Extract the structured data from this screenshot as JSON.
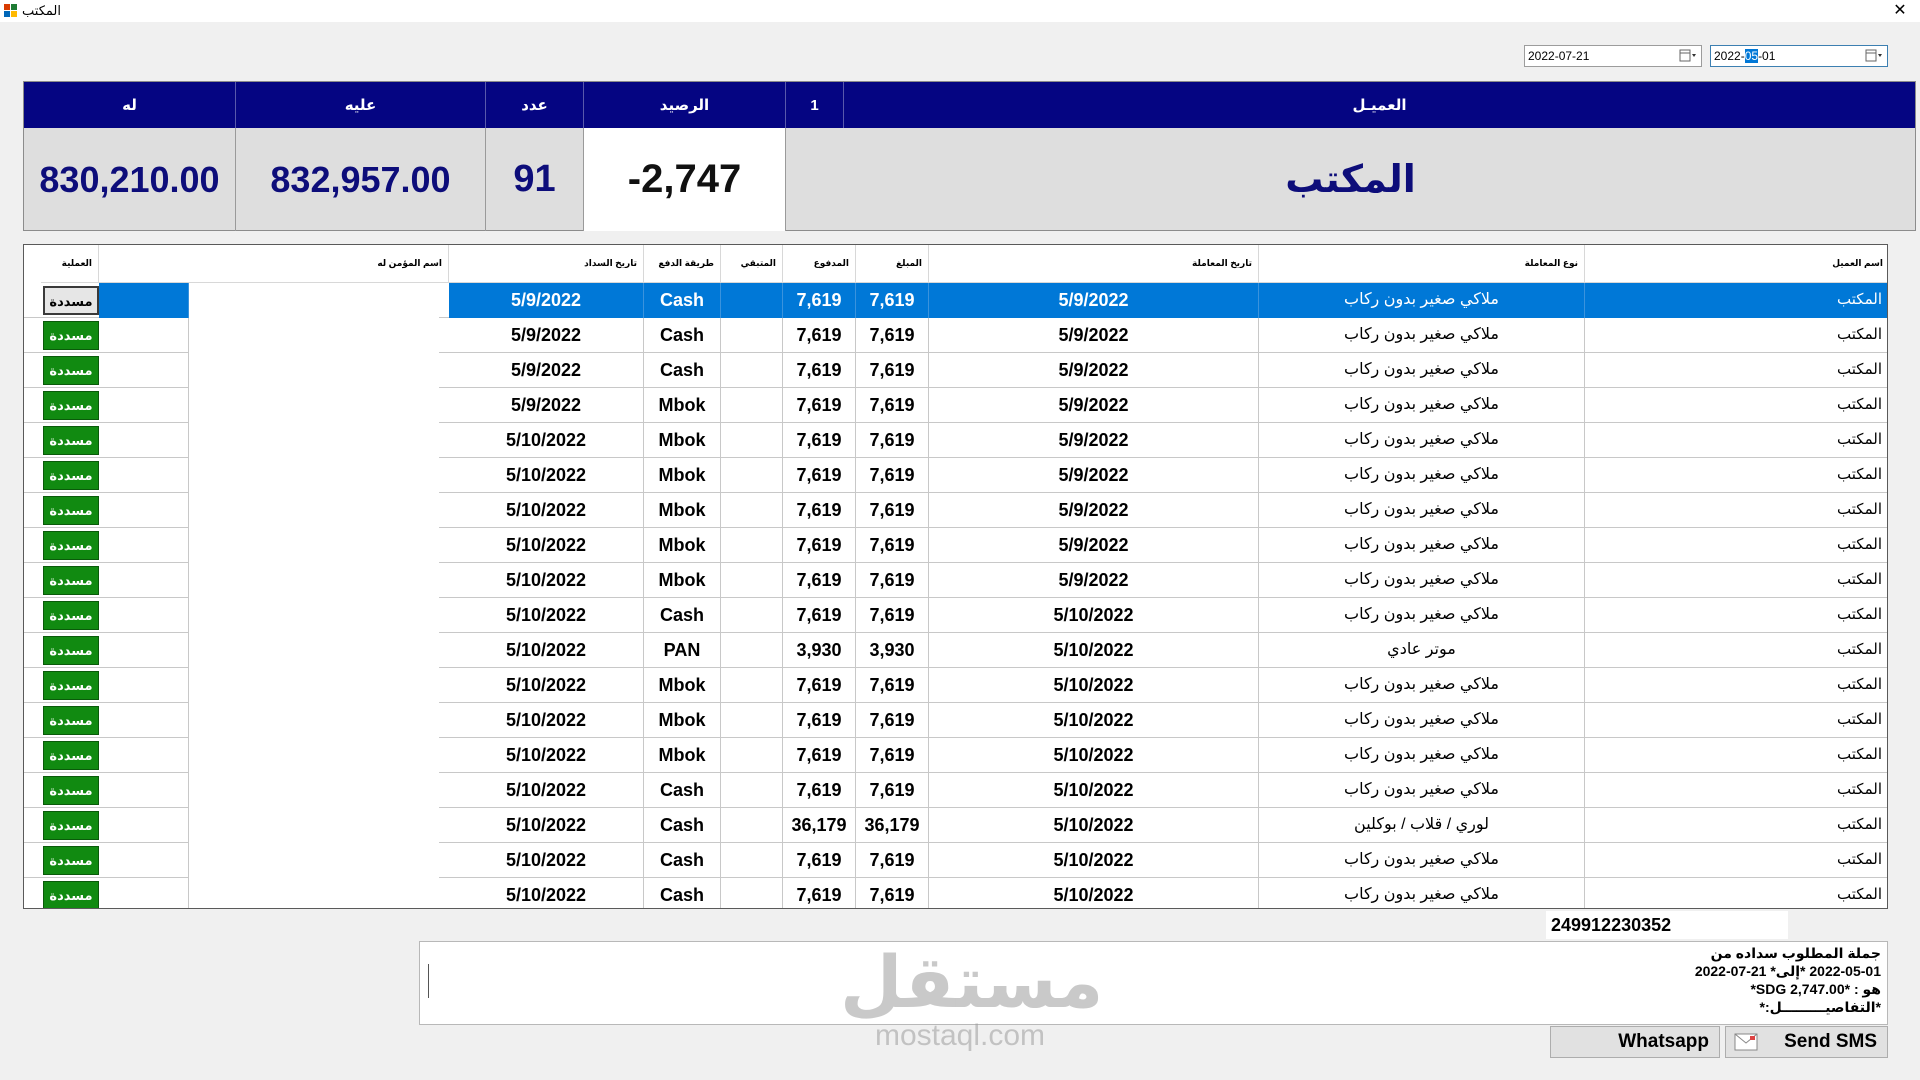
{
  "window": {
    "title": "المكتب",
    "close_symbol": "✕"
  },
  "date_from": {
    "value_pre": "2022-",
    "value_sel": "05",
    "value_post": "-01"
  },
  "date_to": {
    "value": "2022-07-21"
  },
  "summary": {
    "headers": {
      "customer": "العميـل",
      "index": "1",
      "balance": "الرصيد",
      "count": "عدد",
      "debit": "عليه",
      "credit": "له"
    },
    "values": {
      "customer": "المكتب",
      "balance": "-2,747",
      "count": "91",
      "debit": "832,957.00",
      "credit": "830,210.00"
    }
  },
  "grid": {
    "columns": {
      "customer": "اسم العميل",
      "type": "نوع المعاملة",
      "txn_date": "تاريخ المعاملة",
      "amount": "المبلغ",
      "paid": "المدفوع",
      "remaining": "المتبقي",
      "method": "طريقة الدفع",
      "pay_date": "تاريخ السداد",
      "insured": "اسم المؤمن له",
      "op": "العملية"
    },
    "rows": [
      {
        "customer": "المكتب",
        "type": "ملاكي صغير بدون ركاب",
        "txn_date": "5/9/2022",
        "amount": "7,619",
        "paid": "7,619",
        "remaining": "",
        "method": "Cash",
        "pay_date": "5/9/2022",
        "insured": "",
        "op": "مسددة",
        "selected": true
      },
      {
        "customer": "المكتب",
        "type": "ملاكي صغير بدون ركاب",
        "txn_date": "5/9/2022",
        "amount": "7,619",
        "paid": "7,619",
        "remaining": "",
        "method": "Cash",
        "pay_date": "5/9/2022",
        "insured": "",
        "op": "مسددة"
      },
      {
        "customer": "المكتب",
        "type": "ملاكي صغير بدون ركاب",
        "txn_date": "5/9/2022",
        "amount": "7,619",
        "paid": "7,619",
        "remaining": "",
        "method": "Cash",
        "pay_date": "5/9/2022",
        "insured": "",
        "op": "مسددة"
      },
      {
        "customer": "المكتب",
        "type": "ملاكي صغير بدون ركاب",
        "txn_date": "5/9/2022",
        "amount": "7,619",
        "paid": "7,619",
        "remaining": "",
        "method": "Mbok",
        "pay_date": "5/9/2022",
        "insured": "",
        "op": "مسددة"
      },
      {
        "customer": "المكتب",
        "type": "ملاكي صغير بدون ركاب",
        "txn_date": "5/9/2022",
        "amount": "7,619",
        "paid": "7,619",
        "remaining": "",
        "method": "Mbok",
        "pay_date": "5/10/2022",
        "insured": "",
        "op": "مسددة"
      },
      {
        "customer": "المكتب",
        "type": "ملاكي صغير بدون ركاب",
        "txn_date": "5/9/2022",
        "amount": "7,619",
        "paid": "7,619",
        "remaining": "",
        "method": "Mbok",
        "pay_date": "5/10/2022",
        "insured": "",
        "op": "مسددة"
      },
      {
        "customer": "المكتب",
        "type": "ملاكي صغير بدون ركاب",
        "txn_date": "5/9/2022",
        "amount": "7,619",
        "paid": "7,619",
        "remaining": "",
        "method": "Mbok",
        "pay_date": "5/10/2022",
        "insured": "",
        "op": "مسددة"
      },
      {
        "customer": "المكتب",
        "type": "ملاكي صغير بدون ركاب",
        "txn_date": "5/9/2022",
        "amount": "7,619",
        "paid": "7,619",
        "remaining": "",
        "method": "Mbok",
        "pay_date": "5/10/2022",
        "insured": "",
        "op": "مسددة"
      },
      {
        "customer": "المكتب",
        "type": "ملاكي صغير بدون ركاب",
        "txn_date": "5/9/2022",
        "amount": "7,619",
        "paid": "7,619",
        "remaining": "",
        "method": "Mbok",
        "pay_date": "5/10/2022",
        "insured": "",
        "op": "مسددة"
      },
      {
        "customer": "المكتب",
        "type": "ملاكي صغير بدون ركاب",
        "txn_date": "5/10/2022",
        "amount": "7,619",
        "paid": "7,619",
        "remaining": "",
        "method": "Cash",
        "pay_date": "5/10/2022",
        "insured": "",
        "op": "مسددة"
      },
      {
        "customer": "المكتب",
        "type": "موتر عادي",
        "txn_date": "5/10/2022",
        "amount": "3,930",
        "paid": "3,930",
        "remaining": "",
        "method": "PAN",
        "pay_date": "5/10/2022",
        "insured": "",
        "op": "مسددة"
      },
      {
        "customer": "المكتب",
        "type": "ملاكي صغير بدون ركاب",
        "txn_date": "5/10/2022",
        "amount": "7,619",
        "paid": "7,619",
        "remaining": "",
        "method": "Mbok",
        "pay_date": "5/10/2022",
        "insured": "",
        "op": "مسددة"
      },
      {
        "customer": "المكتب",
        "type": "ملاكي صغير بدون ركاب",
        "txn_date": "5/10/2022",
        "amount": "7,619",
        "paid": "7,619",
        "remaining": "",
        "method": "Mbok",
        "pay_date": "5/10/2022",
        "insured": "",
        "op": "مسددة"
      },
      {
        "customer": "المكتب",
        "type": "ملاكي صغير بدون ركاب",
        "txn_date": "5/10/2022",
        "amount": "7,619",
        "paid": "7,619",
        "remaining": "",
        "method": "Mbok",
        "pay_date": "5/10/2022",
        "insured": "",
        "op": "مسددة"
      },
      {
        "customer": "المكتب",
        "type": "ملاكي صغير بدون ركاب",
        "txn_date": "5/10/2022",
        "amount": "7,619",
        "paid": "7,619",
        "remaining": "",
        "method": "Cash",
        "pay_date": "5/10/2022",
        "insured": "",
        "op": "مسددة"
      },
      {
        "customer": "المكتب",
        "type": "لوري / قلاب / بوكلين",
        "txn_date": "5/10/2022",
        "amount": "36,179",
        "paid": "36,179",
        "remaining": "",
        "method": "Cash",
        "pay_date": "5/10/2022",
        "insured": "",
        "op": "مسددة"
      },
      {
        "customer": "المكتب",
        "type": "ملاكي صغير بدون ركاب",
        "txn_date": "5/10/2022",
        "amount": "7,619",
        "paid": "7,619",
        "remaining": "",
        "method": "Cash",
        "pay_date": "5/10/2022",
        "insured": "",
        "op": "مسددة"
      },
      {
        "customer": "المكتب",
        "type": "ملاكي صغير بدون ركاب",
        "txn_date": "5/10/2022",
        "amount": "7,619",
        "paid": "7,619",
        "remaining": "",
        "method": "Cash",
        "pay_date": "5/10/2022",
        "insured": "",
        "op": "مسددة"
      }
    ]
  },
  "phone": {
    "value": "249912230352"
  },
  "message": {
    "lines": [
      "جملة المطلوب سداده من",
      "2022-05-01 *إلى* 21-07-2022",
      "هو : *2,747.00 SDG*",
      "*التفاصيـــــــــل:*"
    ]
  },
  "watermark": {
    "ar": "مستقل",
    "lat": "mostaql.com"
  },
  "buttons": {
    "whatsapp": "Whatsapp",
    "sms": "Send SMS"
  },
  "colors": {
    "header_bg": "#050582",
    "value_text": "#0d0d7a",
    "selected_row": "#0078d7",
    "paid_badge": "#118a11"
  }
}
